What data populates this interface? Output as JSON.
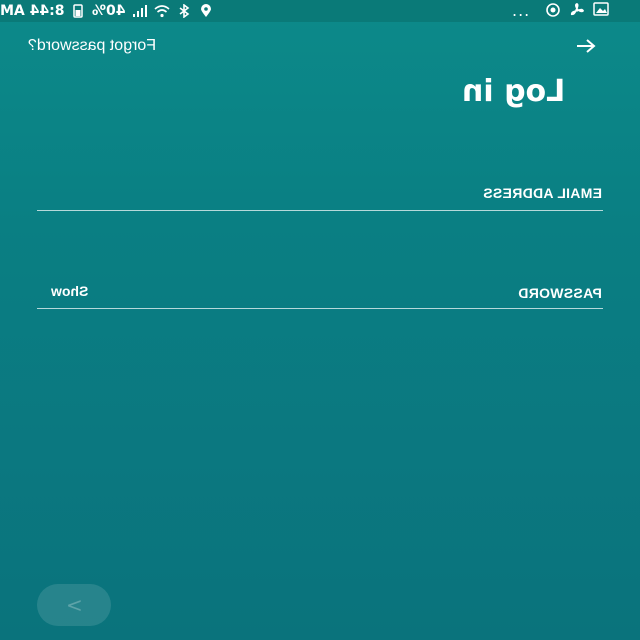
{
  "status_bar": {
    "time": "8:44 AM",
    "battery": "40%",
    "more": "..."
  },
  "header": {
    "forgot_password": "Forgot password?",
    "back_icon": "arrow-right-icon"
  },
  "title": "Log in",
  "form": {
    "email_label": "EMAIL ADDRESS",
    "email_value": "",
    "password_label": "PASSWORD",
    "password_value": "",
    "show_label": "Show"
  },
  "next_button": {
    "icon": "chevron-icon",
    "glyph": ">"
  },
  "colors": {
    "background": "#0b7f83",
    "text": "#ffffff"
  }
}
